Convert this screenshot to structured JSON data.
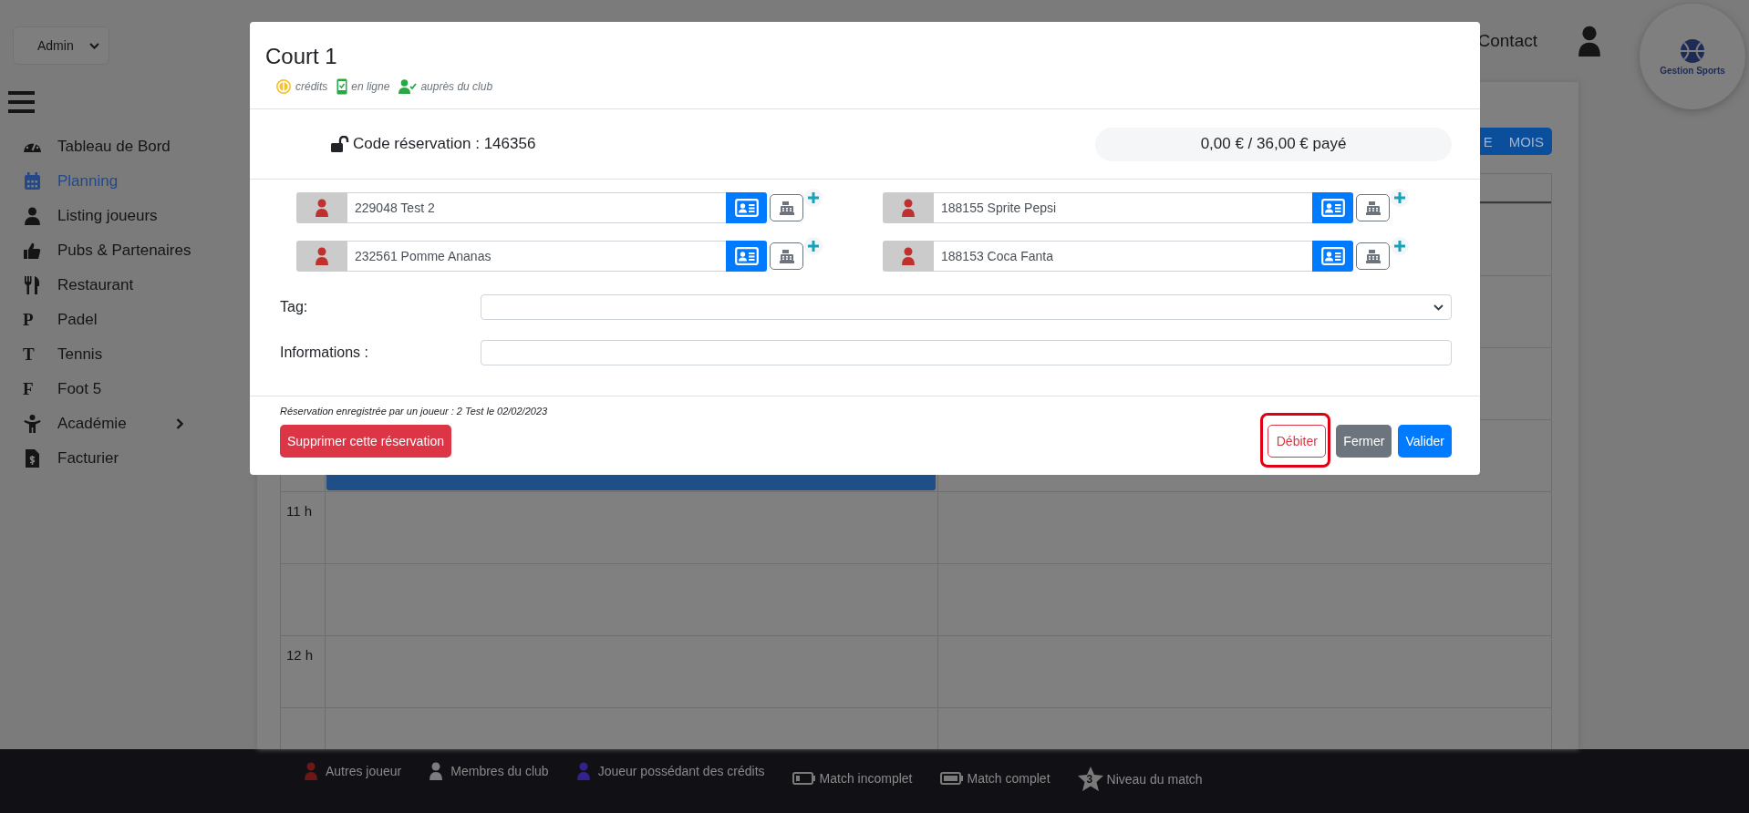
{
  "sidebar": {
    "role_select": {
      "value": "Admin"
    },
    "items": [
      {
        "kind": "gauge",
        "label": "Tableau de Bord",
        "selected": false,
        "submenu": false
      },
      {
        "kind": "calendar",
        "label": "Planning",
        "selected": true,
        "submenu": false
      },
      {
        "kind": "user",
        "label": "Listing joueurs",
        "selected": false,
        "submenu": false
      },
      {
        "kind": "thumb",
        "label": "Pubs & Partenaires",
        "selected": false,
        "submenu": false
      },
      {
        "kind": "cutlery",
        "label": "Restaurant",
        "selected": false,
        "submenu": false
      },
      {
        "kind": "letter",
        "letter": "P",
        "label": "Padel",
        "selected": false,
        "submenu": false
      },
      {
        "kind": "letter",
        "letter": "T",
        "label": "Tennis",
        "selected": false,
        "submenu": false
      },
      {
        "kind": "letter",
        "letter": "F",
        "label": "Foot 5",
        "selected": false,
        "submenu": false
      },
      {
        "kind": "figure",
        "label": "Académie",
        "selected": false,
        "submenu": true
      },
      {
        "kind": "invoice",
        "label": "Facturier",
        "selected": false,
        "submenu": false
      }
    ]
  },
  "header": {
    "contact_link": "Contact",
    "logo_text": "Gestion Sports"
  },
  "calendar": {
    "view_buttons": [
      "E",
      "MOIS"
    ],
    "hours": [
      "11 h",
      "12 h"
    ]
  },
  "modal": {
    "title": "Court 1",
    "legend": [
      {
        "kind": "credits",
        "label": "crédits"
      },
      {
        "kind": "online",
        "label": "en ligne"
      },
      {
        "kind": "club",
        "label": "auprès du club"
      }
    ],
    "code_label": "Code réservation : 146356",
    "payment": "0,00 € / 36,00 € payé",
    "players": [
      {
        "value": "229048 Test 2",
        "color": "#c0302e"
      },
      {
        "value": "188155 Sprite Pepsi",
        "color": "#c0302e"
      },
      {
        "value": "232561 Pomme Ananas",
        "color": "#c0302e"
      },
      {
        "value": "188153 Coca Fanta",
        "color": "#c0302e"
      }
    ],
    "fields": [
      {
        "kind": "select",
        "label": "Tag:"
      },
      {
        "kind": "text",
        "label": "Informations :"
      }
    ],
    "note": "Réservation enregistrée par un joueur : 2 Test le 02/02/2023",
    "buttons": [
      {
        "kind": "danger",
        "label": "Supprimer cette réservation",
        "highlighted": false
      },
      {
        "kind": "outline-danger",
        "label": "Débiter",
        "highlighted": true
      },
      {
        "kind": "secondary",
        "label": "Fermer",
        "highlighted": false
      },
      {
        "kind": "primary",
        "label": "Valider",
        "highlighted": false
      }
    ]
  },
  "legend_bar": [
    {
      "kind": "person",
      "label": "Autres joueur",
      "color": "#6e1717"
    },
    {
      "kind": "person",
      "label": "Membres du club",
      "color": "#7c7c7c"
    },
    {
      "kind": "person",
      "label": "Joueur possédant des crédits",
      "color": "#35208e"
    },
    {
      "kind": "battery-low",
      "label": "Match incomplet"
    },
    {
      "kind": "battery-full",
      "label": "Match complet"
    },
    {
      "kind": "star",
      "label": "Niveau du match",
      "star_text": "3"
    }
  ]
}
